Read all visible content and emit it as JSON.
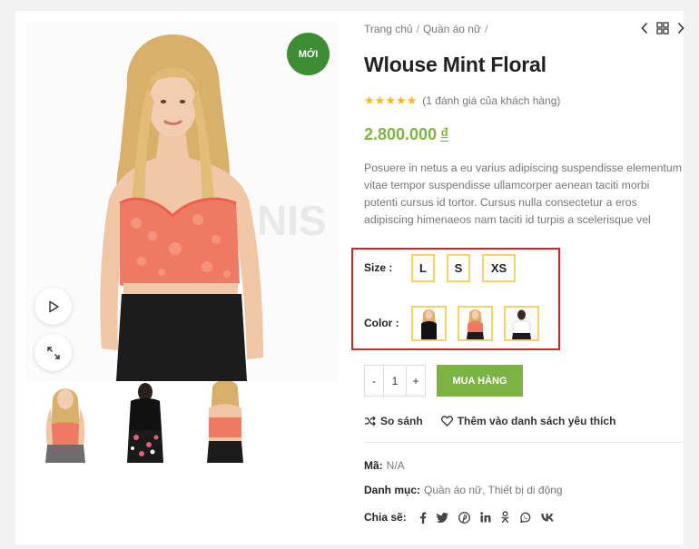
{
  "gallery": {
    "badge": "Mới",
    "play_icon": "play-icon",
    "expand_icon": "expand-icon",
    "thumbnails": [
      "front-coral-top",
      "floral-outfit",
      "back-coral-top"
    ]
  },
  "breadcrumb": {
    "home": "Trang chủ",
    "category": "Quần áo nữ",
    "separator": "/"
  },
  "nav": {
    "prev_icon": "chevron-left-icon",
    "grid_icon": "grid-icon",
    "next_icon": "chevron-right-icon"
  },
  "product": {
    "title": "Wlouse Mint Floral",
    "stars": "★★★★★",
    "reviews": "(1 đánh giá của khách hàng)",
    "price": "2.800.000",
    "currency": "₫",
    "description": "Posuere in netus a eu varius adipiscing suspendisse elementum vitae tempor suspendisse ullamcorper aenean taciti morbi potenti cursus id tortor. Cursus nulla consectetur a eros adipiscing himenaeos nam taciti id turpis a scelerisque vel habitasse."
  },
  "variations": {
    "size_label": "Size",
    "sizes": [
      "L",
      "S",
      "XS"
    ],
    "color_label": "Color",
    "colors": [
      "black-lace",
      "coral-lace",
      "white-top"
    ]
  },
  "cart": {
    "minus": "-",
    "quantity": "1",
    "plus": "+",
    "buy": "Mua hàng"
  },
  "actions": {
    "compare": "So sánh",
    "wishlist": "Thêm vào danh sách yêu thích"
  },
  "meta": {
    "sku_label": "Mã:",
    "sku": "N/A",
    "category_label": "Danh mục:",
    "categories": [
      "Quần áo nữ",
      "Thiết bị di động"
    ],
    "share_label": "Chia sẽ:",
    "share_icons": [
      "facebook-icon",
      "twitter-icon",
      "pinterest-icon",
      "linkedin-icon",
      "odnoklassniki-icon",
      "whatsapp-icon",
      "vk-icon"
    ]
  },
  "colors": {
    "accent": "#7cb342",
    "badge": "#3c8d34",
    "highlight": "#d5232b",
    "swatch_border": "#f1d46a",
    "star": "#f4b91a"
  }
}
